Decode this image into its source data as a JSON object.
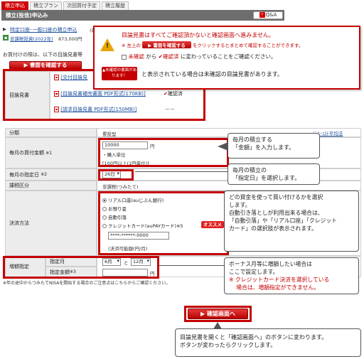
{
  "tabs": [
    "積立申込",
    "積立プラン",
    "次回買付予定",
    "積立履歴"
  ],
  "header": {
    "title": "積立(投信)申込み",
    "qa_label": "Q&A"
  },
  "fund": {
    "link_text": "特定口座･一般口座の積立申込",
    "link_suffix": "(毎",
    "nisa_text": "非課税投資(2022年)",
    "nisa_value": "873,000円"
  },
  "notice_text": "お買付けの際は、以下の目論見書等",
  "btn_docs": "書面を確認する",
  "prospectus": {
    "label": "目論見書",
    "rows": [
      {
        "text": "[交付目論見",
        "status": ""
      },
      {
        "text": "[目論見書補完書面 PDF形式(170KB)]",
        "status": "確認済"
      },
      {
        "text": "[請求目論見書 PDF形式(150MB)]",
        "status": "－－"
      }
    ]
  },
  "form": {
    "category_label": "分類",
    "category_value": "累投型",
    "amount_label": "毎月の買付金額",
    "amount_note": "※1",
    "amount_value": "10000",
    "amount_unit": "円",
    "amount_sub": "・購入単位",
    "amount_range": "[100円以上(1円単位)]",
    "day_label": "毎月の指定日",
    "day_note": "※2",
    "day_value": "26日",
    "tax_label": "課税区分",
    "tax_value": "非課税(つみたて)",
    "pay_label": "決済方法",
    "pay_options": [
      "リアル口座(auじぶん銀行)",
      "お預り金",
      "自動引落",
      "クレジットカード(auPAYカード)※5"
    ],
    "card_number": "****-******-0000",
    "card_note": "(決済可能額(円/月)",
    "osusume": "オススメ",
    "bonus_label": "増額指定",
    "bonus_month_label": "指定月",
    "bonus_amount_label": "指定金額",
    "bonus_amount_note": "※3",
    "bonus_month_from": "6月",
    "bonus_and": "と",
    "bonus_month_to": "12月",
    "bonus_amount_unit": "円",
    "footnote": "※年の途中からつみたてNISAを開始する場合のご注意点はこちらからご確認ください。"
  },
  "topcallout": {
    "line1": "目論見書はすべてご確認頂かないと確認画面へ進みません。",
    "line2a": "※ 左上の",
    "line2btn": "書面を確認する",
    "line2b": "をクリックするとまとめて確認することができます。",
    "line3a": "未確認",
    "line3b": "から",
    "line3c": "確認済",
    "line3d": "に変わっていることをご確認ください。",
    "badge": "未確認の書面があります！",
    "line4": "と表示されている場合は未確認の目論見書があります。"
  },
  "callouts": {
    "amount": [
      "毎月の積立する",
      "「金額」を入力します。"
    ],
    "day": [
      "毎月の積立の",
      "「指定日」を選択します。"
    ],
    "pay": [
      "どの資金を使って買い付けるかを選択",
      "します。",
      "自動引き落としが利用出来る場合は、",
      "「自動引落」や「リアル口座」「クレジット",
      "カード」の選択肢が表示されます。"
    ],
    "bonus": [
      "ボーナス月等に増額したい場合は",
      "ここで設定します。",
      "※ クレジットカード決済を選択している",
      "　 場合は、増額指定ができません。"
    ],
    "confirm": [
      "目論見書を開くと「確認画面へ」のボタンに変わります。",
      "ボタンが変わったらクリックします。"
    ]
  },
  "btn_confirm": "確認画面へ",
  "colors": {
    "brand_red": "#c40000",
    "header_gray": "#6e6e6e"
  }
}
